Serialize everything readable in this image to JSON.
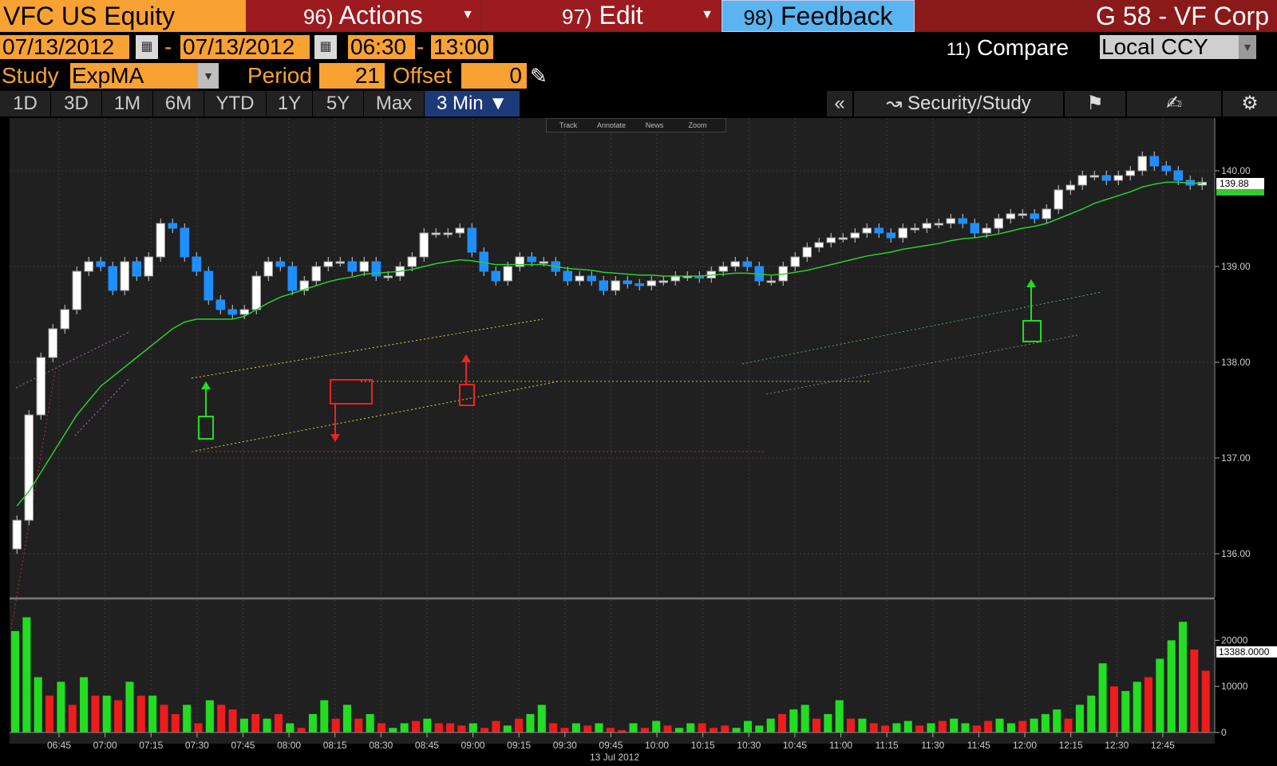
{
  "header": {
    "security": "VFC US Equity",
    "actions": {
      "num": "96)",
      "label": "Actions"
    },
    "edit": {
      "num": "97)",
      "label": "Edit"
    },
    "feedback": {
      "num": "98)",
      "label": "Feedback"
    },
    "title": "G 58 - VF Corp"
  },
  "range": {
    "start_date": "07/13/2012",
    "separator": "-",
    "end_date": "07/13/2012",
    "start_time": "06:30",
    "end_time": "13:00",
    "compare": {
      "num": "11)",
      "label": "Compare"
    },
    "currency": "Local CCY"
  },
  "study": {
    "label": "Study",
    "value": "ExpMA",
    "period_label": "Period",
    "period": "21",
    "offset_label": "Offset",
    "offset": "0"
  },
  "tabs": [
    "1D",
    "3D",
    "1M",
    "6M",
    "YTD",
    "1Y",
    "5Y",
    "Max"
  ],
  "active_tab": "3 Min ▼",
  "tools": {
    "collapse": "«",
    "security_study": "Security/Study"
  },
  "mini_toolbar": [
    "Track",
    "Annotate",
    "News",
    "Zoom"
  ],
  "colors": {
    "up_candle": "#ffffff",
    "down_candle": "#1e8fff",
    "ema": "#2ecc2e",
    "vol_up": "#22dd22",
    "vol_down": "#ee1c1c",
    "grid": "#3a3a3a"
  },
  "chart_data": [
    {
      "type": "candlestick",
      "title": "",
      "x_tick_labels": [
        "06:45",
        "07:00",
        "07:15",
        "07:30",
        "07:45",
        "08:00",
        "08:15",
        "08:30",
        "08:45",
        "09:00",
        "09:15",
        "09:30",
        "09:45",
        "10:00",
        "10:15",
        "10:30",
        "10:45",
        "11:00",
        "11:15",
        "11:30",
        "11:45",
        "12:00",
        "12:15",
        "12:30",
        "12:45"
      ],
      "x_caption": "13 Jul 2012",
      "y_tick_labels": [
        "140.00",
        "139.00",
        "138.00",
        "137.00",
        "136.00"
      ],
      "ylim": [
        135.55,
        140.55
      ],
      "last_price": "139.88",
      "ema_period": 21,
      "close": [
        136.35,
        137.45,
        138.05,
        138.35,
        138.55,
        138.95,
        139.05,
        139.0,
        138.75,
        139.05,
        138.9,
        139.1,
        139.45,
        139.4,
        139.1,
        138.95,
        138.65,
        138.55,
        138.5,
        138.55,
        138.9,
        139.05,
        139.0,
        138.75,
        138.85,
        139.0,
        139.05,
        139.05,
        138.95,
        139.05,
        138.9,
        138.9,
        139.0,
        139.1,
        139.35,
        139.35,
        139.35,
        139.4,
        139.15,
        138.95,
        138.85,
        139.0,
        139.1,
        139.05,
        139.05,
        138.95,
        138.85,
        138.9,
        138.85,
        138.75,
        138.85,
        138.82,
        138.8,
        138.85,
        138.85,
        138.9,
        138.9,
        138.88,
        138.95,
        139.0,
        139.05,
        139.0,
        138.85,
        138.85,
        139.0,
        139.1,
        139.2,
        139.25,
        139.3,
        139.3,
        139.35,
        139.4,
        139.35,
        139.3,
        139.4,
        139.4,
        139.45,
        139.45,
        139.5,
        139.45,
        139.35,
        139.4,
        139.5,
        139.55,
        139.55,
        139.5,
        139.6,
        139.8,
        139.85,
        139.95,
        139.95,
        139.9,
        139.95,
        140.0,
        140.15,
        140.05,
        140.0,
        139.9,
        139.85,
        139.88
      ],
      "ema": [
        136.5,
        136.65,
        136.85,
        137.05,
        137.25,
        137.45,
        137.6,
        137.75,
        137.85,
        137.95,
        138.05,
        138.15,
        138.25,
        138.35,
        138.42,
        138.45,
        138.45,
        138.45,
        138.45,
        138.48,
        138.55,
        138.62,
        138.68,
        138.72,
        138.76,
        138.8,
        138.84,
        138.87,
        138.89,
        138.92,
        138.93,
        138.94,
        138.95,
        138.97,
        139.0,
        139.03,
        139.05,
        139.07,
        139.06,
        139.04,
        139.02,
        139.02,
        139.02,
        139.02,
        139.02,
        139.0,
        138.98,
        138.97,
        138.96,
        138.94,
        138.93,
        138.92,
        138.91,
        138.91,
        138.9,
        138.9,
        138.9,
        138.9,
        138.91,
        138.92,
        138.93,
        138.93,
        138.92,
        138.91,
        138.92,
        138.94,
        138.96,
        138.99,
        139.02,
        139.05,
        139.08,
        139.11,
        139.13,
        139.15,
        139.18,
        139.2,
        139.22,
        139.24,
        139.27,
        139.29,
        139.3,
        139.32,
        139.34,
        139.37,
        139.4,
        139.42,
        139.45,
        139.5,
        139.55,
        139.6,
        139.66,
        139.7,
        139.74,
        139.78,
        139.83,
        139.86,
        139.88,
        139.88,
        139.87,
        139.87
      ]
    },
    {
      "type": "bar",
      "title": "",
      "y_tick_labels": [
        "20000",
        "10000",
        "0"
      ],
      "ylim": [
        0,
        27000
      ],
      "last_value": "13388.0000",
      "values": [
        22000,
        25000,
        12000,
        8000,
        11000,
        6000,
        12000,
        8000,
        8000,
        7000,
        11000,
        8000,
        8000,
        6000,
        4000,
        6000,
        2000,
        7000,
        6000,
        5000,
        3000,
        4000,
        3000,
        4000,
        2000,
        1000,
        4000,
        7000,
        3000,
        6000,
        3000,
        4000,
        2000,
        1000,
        2000,
        2500,
        3000,
        2000,
        2000,
        1500,
        2000,
        1000,
        2500,
        1500,
        3000,
        4000,
        6000,
        2000,
        1000,
        2000,
        1500,
        2000,
        1000,
        500,
        2000,
        1000,
        2500,
        1500,
        1000,
        2000,
        2000,
        1000,
        1500,
        1000,
        2500,
        1500,
        3000,
        4000,
        5000,
        6000,
        3000,
        4000,
        7000,
        3000,
        3000,
        2000,
        1500,
        2000,
        2500,
        1500,
        2000,
        2500,
        3000,
        2000,
        1500,
        2500,
        3000,
        2000,
        2500,
        3000,
        4000,
        5000,
        3000,
        6000,
        8000,
        15000,
        10000,
        9000,
        11000,
        12000,
        16000,
        20000,
        24000,
        18000,
        13388
      ],
      "up": [
        1,
        1,
        1,
        0,
        1,
        0,
        1,
        0,
        1,
        0,
        1,
        0,
        1,
        0,
        0,
        1,
        0,
        1,
        0,
        0,
        1,
        0,
        1,
        0,
        1,
        0,
        1,
        1,
        0,
        1,
        0,
        1,
        0,
        1,
        1,
        0,
        1,
        0,
        0,
        0,
        1,
        0,
        0,
        1,
        0,
        1,
        1,
        0,
        0,
        1,
        0,
        1,
        0,
        0,
        1,
        0,
        1,
        0,
        1,
        1,
        0,
        0,
        0,
        1,
        1,
        1,
        1,
        0,
        1,
        1,
        0,
        1,
        1,
        0,
        1,
        0,
        0,
        1,
        1,
        0,
        1,
        0,
        1,
        1,
        0,
        0,
        1,
        1,
        0,
        1,
        1,
        1,
        0,
        1,
        1,
        1,
        0,
        1,
        1,
        0,
        1,
        1,
        1,
        0,
        0
      ]
    }
  ]
}
